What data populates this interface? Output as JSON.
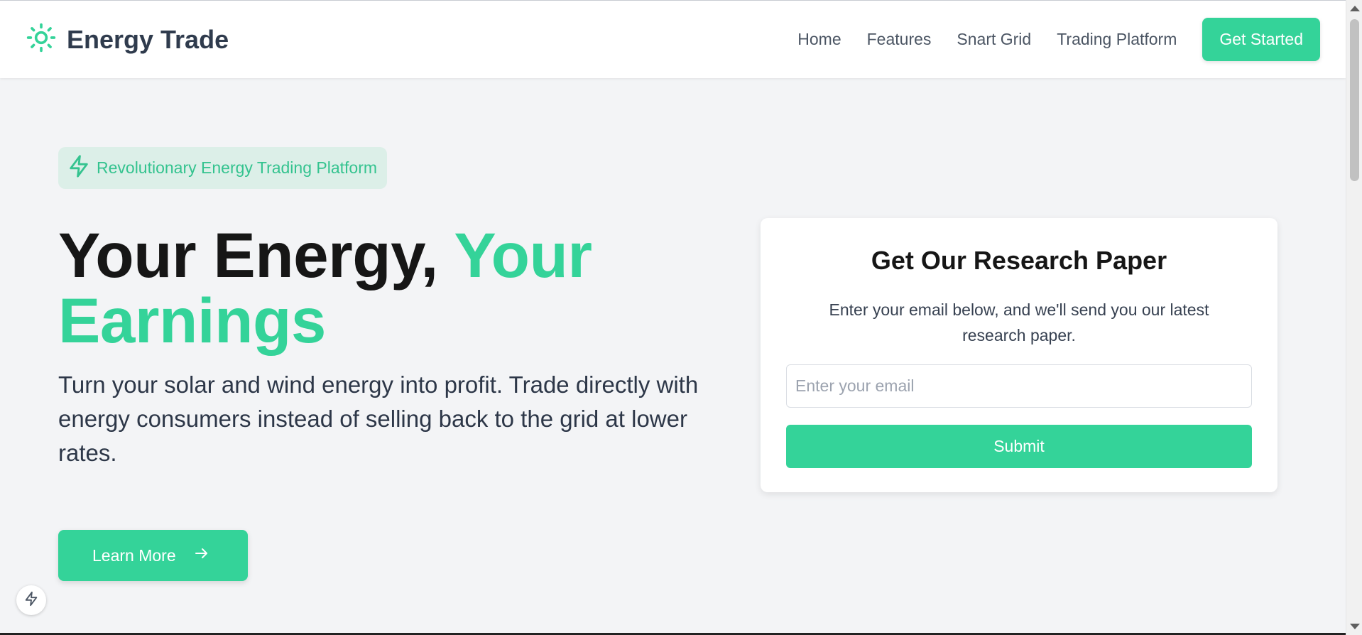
{
  "header": {
    "brand_name": "Energy Trade",
    "brand_icon": "sun-icon",
    "nav": [
      "Home",
      "Features",
      "Snart Grid",
      "Trading Platform"
    ],
    "cta_label": "Get Started"
  },
  "hero": {
    "badge_label": "Revolutionary Energy Trading Platform",
    "badge_icon": "lightning-icon",
    "title_part1": "Your Energy,",
    "title_part2": "Your Earnings",
    "description": "Turn your solar and wind energy into profit. Trade directly with energy consumers instead of selling back to the grid at lower rates.",
    "learn_more_label": "Learn More",
    "learn_more_icon": "arrow-right-icon"
  },
  "research_card": {
    "title": "Get Our Research Paper",
    "description": "Enter your email below, and we'll send you our latest research paper.",
    "email_placeholder": "Enter your email",
    "submit_label": "Submit"
  },
  "colors": {
    "accent": "#34d399",
    "badge_bg": "#dcefe8",
    "page_bg": "#f3f4f6",
    "heading": "#161616"
  }
}
